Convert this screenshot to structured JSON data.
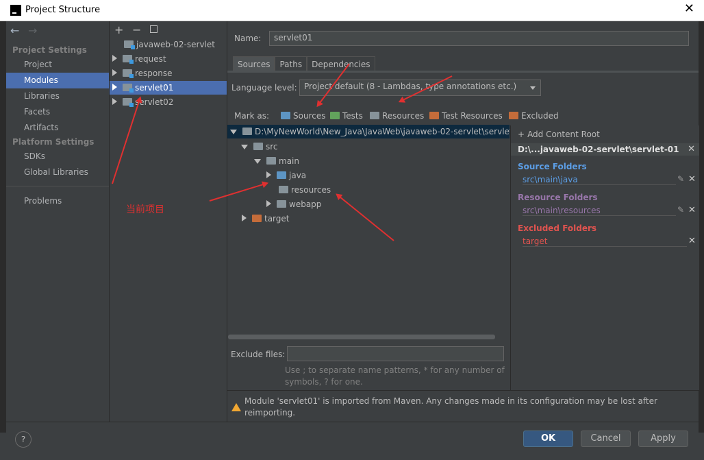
{
  "window": {
    "title": "Project Structure"
  },
  "left_nav": {
    "project_settings": "Project Settings",
    "items_ps": [
      "Project",
      "Modules",
      "Libraries",
      "Facets",
      "Artifacts"
    ],
    "platform_settings": "Platform Settings",
    "items_platform": [
      "SDKs",
      "Global Libraries"
    ],
    "problems": "Problems"
  },
  "modules": {
    "toolbar": [
      "+",
      "−",
      "copy"
    ],
    "items": [
      "javaweb-02-servlet",
      "request",
      "response",
      "servlet01",
      "servlet02"
    ],
    "selected": "servlet01"
  },
  "annotation": {
    "current_project": "当前项目"
  },
  "main": {
    "name_label": "Name:",
    "name_value": "servlet01",
    "tabs": [
      "Sources",
      "Paths",
      "Dependencies"
    ],
    "language_level_label": "Language level:",
    "language_level_value": "Project default (8 - Lambdas, type annotations etc.)",
    "mark_as_label": "Mark as:",
    "mark_as": [
      "Sources",
      "Tests",
      "Resources",
      "Test Resources",
      "Excluded"
    ],
    "tree": {
      "root": "D:\\MyNewWorld\\New_Java\\JavaWeb\\javaweb-02-servlet\\servlet",
      "src": "src",
      "main": "main",
      "java": "java",
      "resources": "resources",
      "webapp": "webapp",
      "target": "target"
    },
    "exclude_files_label": "Exclude files:",
    "exclude_help": "Use ; to separate name patterns, * for any number of symbols, ? for one.",
    "warning": "Module 'servlet01' is imported from Maven. Any changes made in its configuration may be lost after reimporting."
  },
  "content_root": {
    "add_label": "Add Content Root",
    "path": "D:\\...javaweb-02-servlet\\servlet-01",
    "source_folders": "Source Folders",
    "source_path": "src\\main\\java",
    "resource_folders": "Resource Folders",
    "resource_path": "src\\main\\resources",
    "excluded_folders": "Excluded Folders",
    "excluded_path": "target",
    "colors": {
      "source": "#5c9ee6",
      "resource": "#9876aa",
      "excluded": "#e0534f"
    }
  },
  "footer": {
    "help": "?",
    "ok": "OK",
    "cancel": "Cancel",
    "apply": "Apply"
  }
}
